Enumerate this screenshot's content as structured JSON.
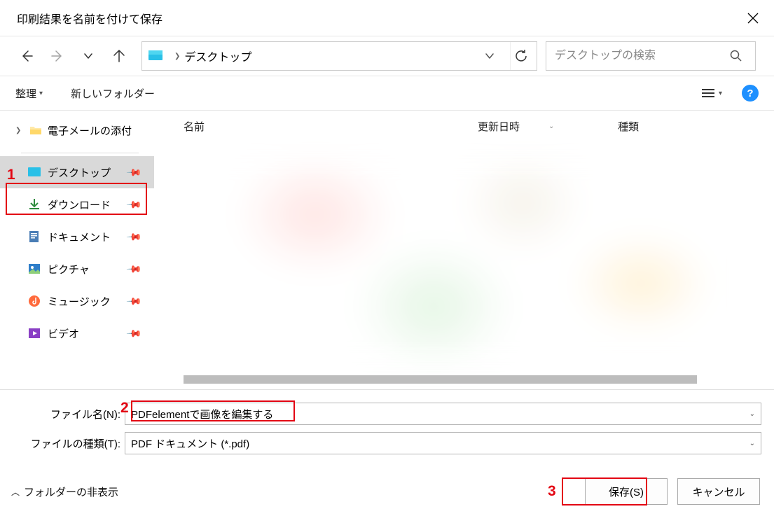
{
  "title": "印刷結果を名前を付けて保存",
  "nav": {
    "current_folder": "デスクトップ"
  },
  "search": {
    "placeholder": "デスクトップの検索"
  },
  "toolbar": {
    "organize": "整理",
    "new_folder": "新しいフォルダー"
  },
  "tree": {
    "attachments": "電子メールの添付"
  },
  "quick": {
    "desktop": "デスクトップ",
    "downloads": "ダウンロード",
    "documents": "ドキュメント",
    "pictures": "ピクチャ",
    "music": "ミュージック",
    "videos": "ビデオ"
  },
  "columns": {
    "name": "名前",
    "date": "更新日時",
    "type": "種類"
  },
  "form": {
    "filename_label": "ファイル名(N):",
    "filename_value": "PDFelementで画像を編集する",
    "filetype_label": "ファイルの種類(T):",
    "filetype_value": "PDF ドキュメント (*.pdf)"
  },
  "footer": {
    "hide_folders": "フォルダーの非表示",
    "save": "保存(S)",
    "cancel": "キャンセル"
  },
  "annotations": {
    "a1": "1",
    "a2": "2",
    "a3": "3"
  },
  "help": "?"
}
